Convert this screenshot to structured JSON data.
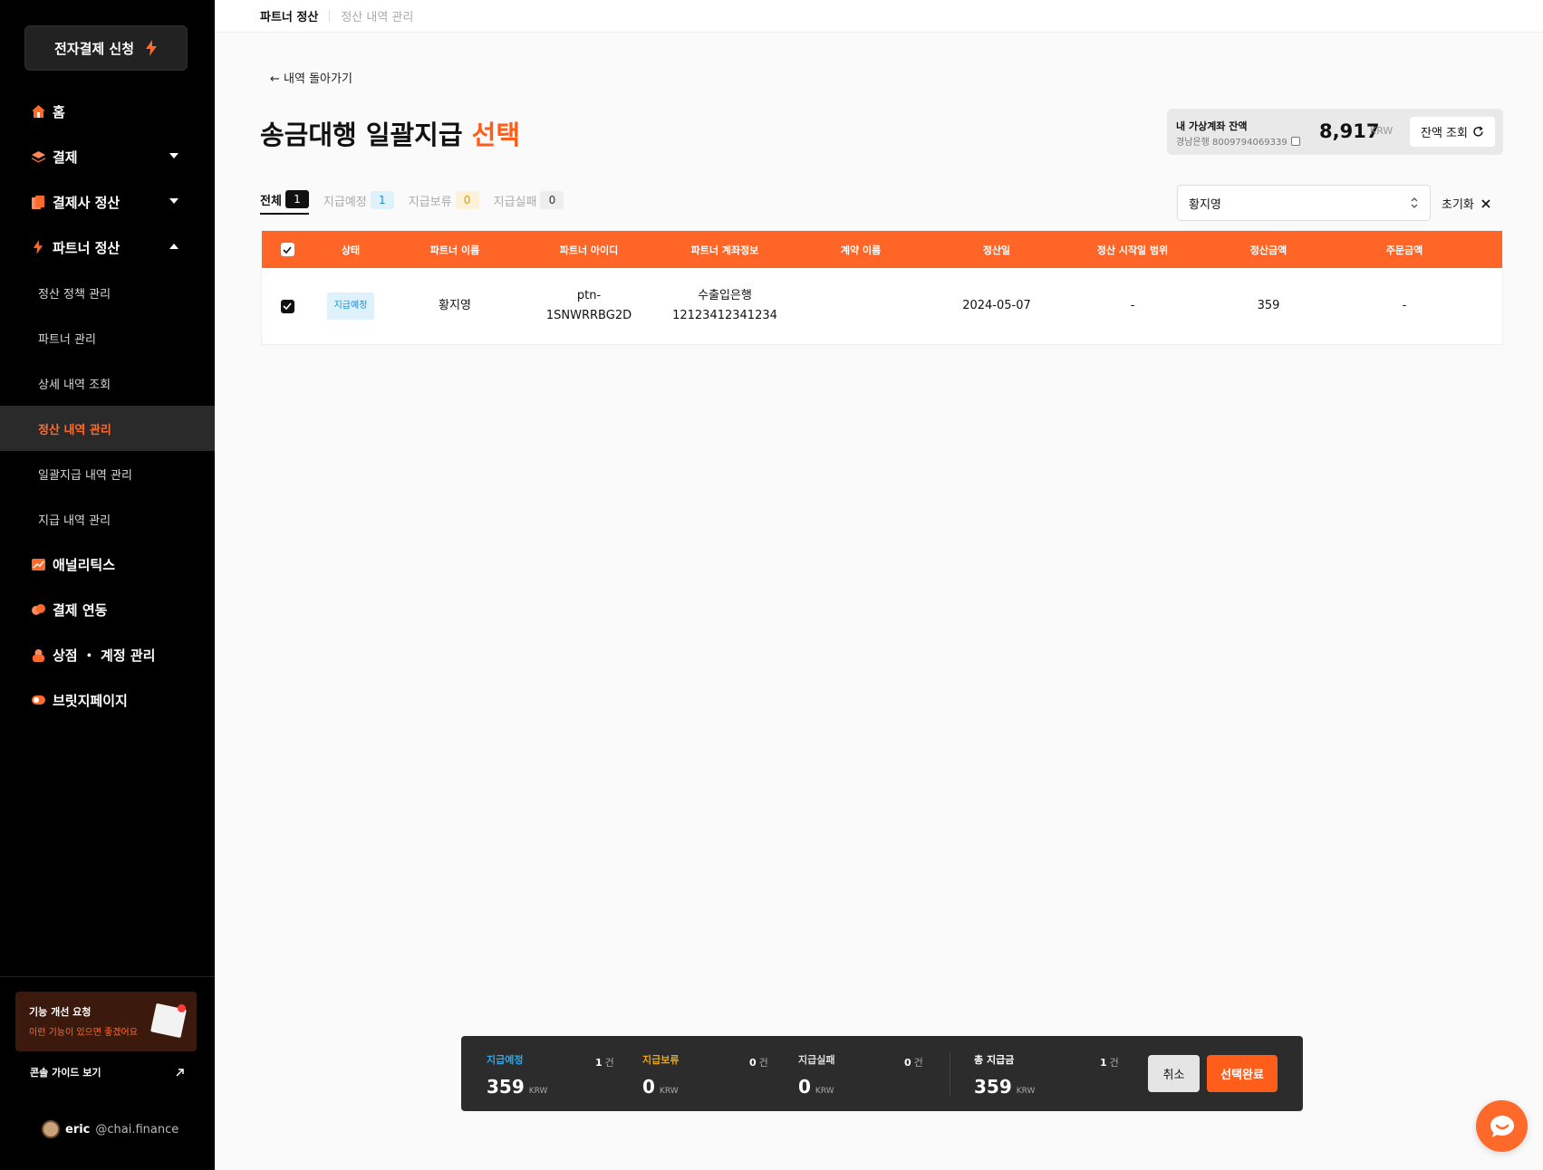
{
  "sidebar": {
    "apply_button": "전자결제 신청",
    "nav": [
      {
        "label": "홈"
      },
      {
        "label": "결제"
      },
      {
        "label": "결제사 정산"
      },
      {
        "label": "파트너 정산"
      },
      {
        "label": "애널리틱스"
      },
      {
        "label": "결제 연동"
      },
      {
        "label": "상점 ・ 계정 관리"
      },
      {
        "label": "브릿지페이지"
      }
    ],
    "sub_items": [
      {
        "label": "정산 정책 관리"
      },
      {
        "label": "파트너 관리"
      },
      {
        "label": "상세 내역 조회"
      },
      {
        "label": "정산 내역 관리"
      },
      {
        "label": "일괄지급 내역 관리"
      },
      {
        "label": "지급 내역 관리"
      }
    ],
    "feedback": {
      "title": "기능 개선 요청",
      "subtitle": "이런 기능이 있으면 좋겠어요"
    },
    "guide": "콘솔 가이드 보기",
    "user": {
      "name": "eric",
      "domain": "@chai.finance"
    }
  },
  "breadcrumb": {
    "first": "파트너 정산",
    "second": "정산 내역 관리"
  },
  "back_label": "← 내역 돌아가기",
  "title": {
    "main": "송금대행 일괄지급",
    "accent": "선택"
  },
  "balance": {
    "label": "내 가상계좌 잔액",
    "account": "경남은행 8009794069339",
    "amount": "8,917",
    "unit": "KRW",
    "button": "잔액 조회"
  },
  "tabs": [
    {
      "label": "전체",
      "count": "1"
    },
    {
      "label": "지급예정",
      "count": "1"
    },
    {
      "label": "지급보류",
      "count": "0"
    },
    {
      "label": "지급실패",
      "count": "0"
    }
  ],
  "filter": {
    "value": "황지영",
    "reset": "초기화"
  },
  "table": {
    "headers": [
      "상태",
      "파트너 이름",
      "파트너 아이디",
      "파트너 계좌정보",
      "계약 이름",
      "정산일",
      "정산 시작일 범위",
      "정산금액",
      "주문금액"
    ],
    "rows": [
      {
        "status": "지급예정",
        "partner_name": "황지영",
        "partner_id_1": "ptn-",
        "partner_id_2": "1SNWRRBG2D",
        "bank_name": "수출입은행",
        "bank_account": "12123412341234",
        "contract": "",
        "settle_date": "2024-05-07",
        "settle_range": "-",
        "settle_amount": "359",
        "order_amount": "-"
      }
    ]
  },
  "summary": {
    "scheduled": {
      "label": "지급예정",
      "count": "1",
      "amount": "359",
      "unit": "KRW",
      "color": "#2fa8e8"
    },
    "hold": {
      "label": "지급보류",
      "count": "0",
      "amount": "0",
      "unit": "KRW",
      "color": "#f0a500"
    },
    "failed": {
      "label": "지급실패",
      "count": "0",
      "amount": "0",
      "unit": "KRW",
      "color": "#dddddd"
    },
    "total": {
      "label": "총 지급금",
      "count": "1",
      "amount": "359",
      "unit": "KRW",
      "color": "#ffffff"
    },
    "count_unit": "건",
    "cancel": "취소",
    "confirm": "선택완료"
  },
  "colors": {
    "accent": "#ff5e1a",
    "header": "#ff6527",
    "sidebar": "#000000"
  }
}
